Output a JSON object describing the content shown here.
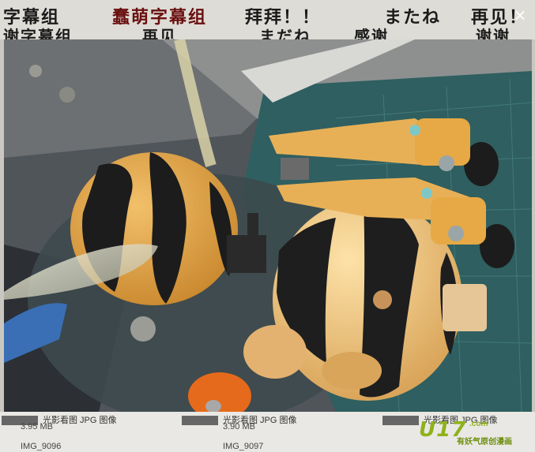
{
  "banner": {
    "row1": [
      "字幕组",
      "蠢萌字幕组",
      "拜拜！！",
      "またね",
      "再见！"
    ],
    "row2": [
      "谢字幕组",
      "再见",
      "まだね",
      "感谢",
      "谢谢"
    ]
  },
  "viewer": {
    "close_label": "×"
  },
  "files": [
    {
      "type": "光影看图 JPG 图像",
      "size": "3.95 MB",
      "name": "IMG_9096"
    },
    {
      "type": "光影看图 JPG 图像",
      "size": "3.90 MB",
      "name": "IMG_9097"
    },
    {
      "type": "光影看图 JPG 图像",
      "size": "",
      "name": ""
    }
  ],
  "watermark": {
    "logo": "U17",
    "com": ".com",
    "tagline": "有妖气原创漫画"
  }
}
